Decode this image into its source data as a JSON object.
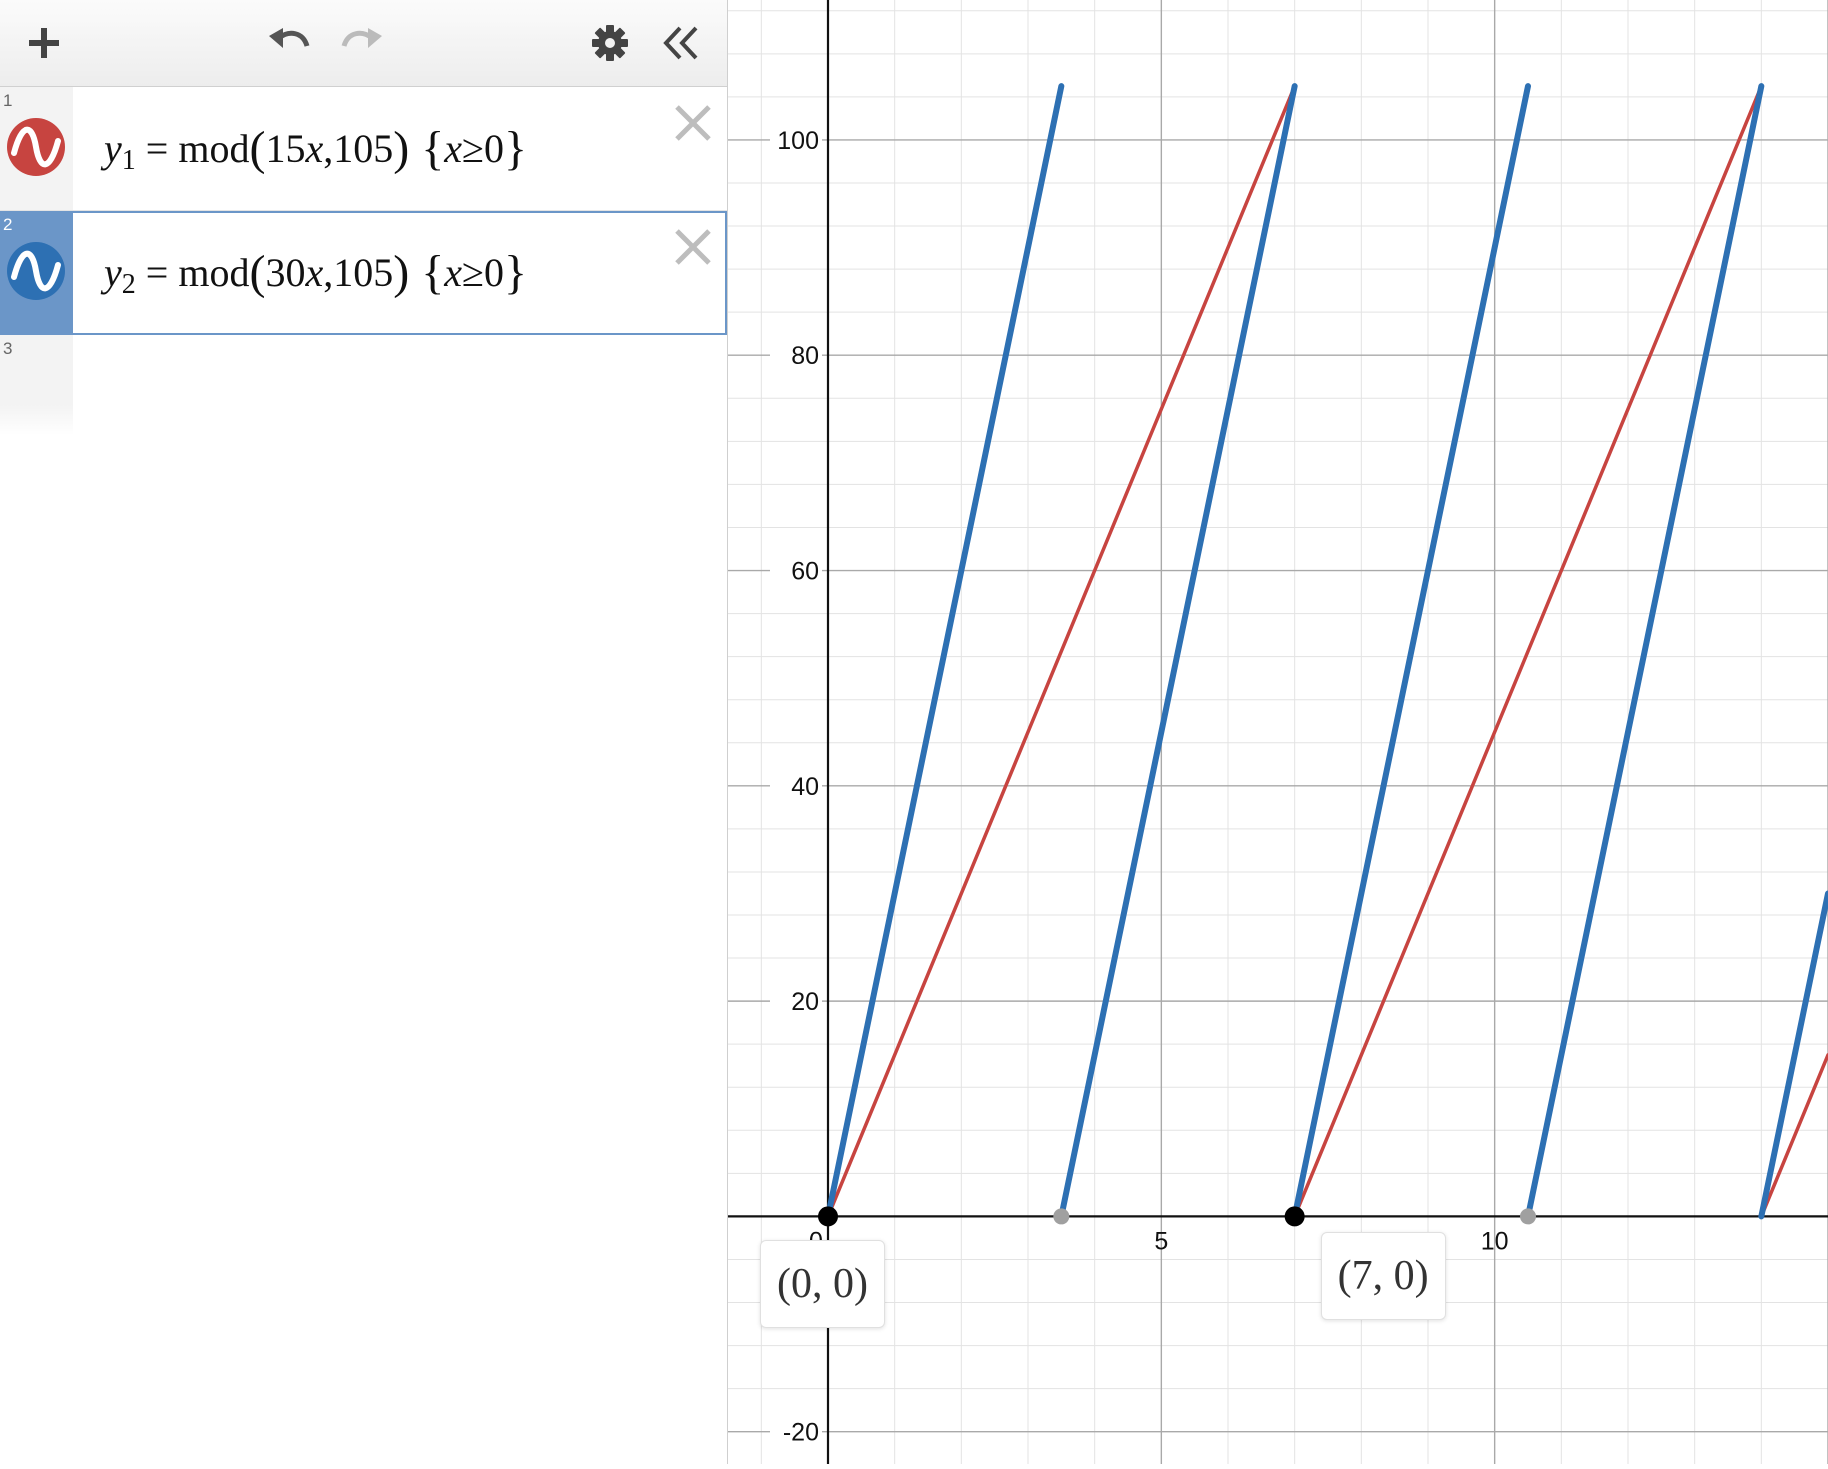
{
  "toolbar": {
    "add_icon": "plus-icon",
    "undo_icon": "undo-icon",
    "redo_icon": "redo-icon",
    "settings_icon": "gear-icon",
    "collapse_icon": "double-chevron-left-icon"
  },
  "expressions": [
    {
      "index": "1",
      "color": "#c74440",
      "lhs_var": "y",
      "lhs_sub": "1",
      "fn": "mod",
      "arg_coef": "15",
      "arg_var": "x",
      "arg_mod": "105",
      "cond_var": "x",
      "cond_op": "≥",
      "cond_val": "0",
      "selected": false
    },
    {
      "index": "2",
      "color": "#2d70b3",
      "lhs_var": "y",
      "lhs_sub": "2",
      "fn": "mod",
      "arg_coef": "30",
      "arg_var": "x",
      "arg_mod": "105",
      "cond_var": "x",
      "cond_op": "≥",
      "cond_val": "0",
      "selected": true
    }
  ],
  "empty_row_index": "3",
  "point_labels": [
    {
      "text": "(0, 0)",
      "x": 0,
      "y": 0
    },
    {
      "text": "(7, 0)",
      "x": 7,
      "y": 0
    }
  ],
  "chart_data": {
    "type": "line",
    "xlim": [
      -1.5,
      15
    ],
    "ylim": [
      -23,
      113
    ],
    "x_major_ticks": [
      "0",
      "5",
      "10"
    ],
    "y_major_ticks": [
      "-20",
      "20",
      "40",
      "60",
      "80",
      "100"
    ],
    "grid": true,
    "series": [
      {
        "expression_index": 1,
        "color": "#c74440",
        "function": "mod(15x,105)",
        "slope": 15,
        "period": 105,
        "domain_min": 0
      },
      {
        "expression_index": 2,
        "color": "#2d70b3",
        "function": "mod(30x,105)",
        "slope": 30,
        "period": 105,
        "domain_min": 0
      }
    ],
    "points": [
      {
        "x": 0,
        "y": 0,
        "color": "#000000"
      },
      {
        "x": 3.5,
        "y": 0,
        "color": "#a0a0a0"
      },
      {
        "x": 7,
        "y": 0,
        "color": "#000000"
      },
      {
        "x": 10.5,
        "y": 0,
        "color": "#a0a0a0"
      }
    ]
  }
}
